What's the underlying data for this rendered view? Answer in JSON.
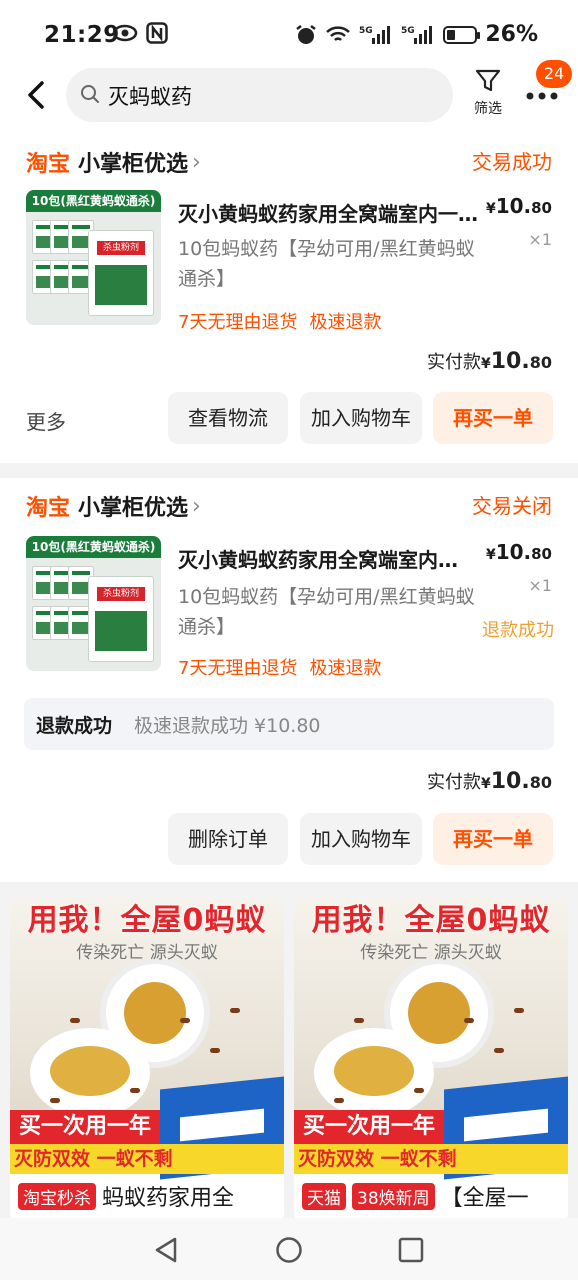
{
  "status": {
    "time": "21:29",
    "battery": "26%"
  },
  "search": {
    "query": "灭蚂蚁药",
    "filter_label": "筛选",
    "badge_count": "24"
  },
  "orders": [
    {
      "shop_brand": "淘宝",
      "shop_name": "小掌柜优选",
      "status": "交易成功",
      "product_title": "灭小黄蚂蚁药家用全窝端室内一次性杀",
      "price_symbol": "¥",
      "price_int": "10.",
      "price_dec": "80",
      "sku": "10包蚂蚁药【孕幼可用/黑红黄蚂蚁通杀】",
      "qty": "×1",
      "tags": [
        "7天无理由退货",
        "极速退款"
      ],
      "paid_label": "实付款",
      "paid_int": "10.",
      "paid_dec": "80",
      "more_label": "更多",
      "buttons": [
        "查看物流",
        "加入购物车",
        "再买一单"
      ],
      "thumb_banner": "10包(黑红黄蚂蚁通杀)",
      "thumb_label": "杀虫粉剂"
    },
    {
      "shop_brand": "淘宝",
      "shop_name": "小掌柜优选",
      "status": "交易关闭",
      "product_title": "灭小黄蚂蚁药家用全窝端室内一次性杀",
      "price_symbol": "¥",
      "price_int": "10.",
      "price_dec": "80",
      "sku": "10包蚂蚁药【孕幼可用/黑红黄蚂蚁通杀】",
      "qty": "×1",
      "refund_tag": "退款成功",
      "tags": [
        "7天无理由退货",
        "极速退款"
      ],
      "refund_title": "退款成功",
      "refund_desc": "极速退款成功 ¥10.80",
      "paid_label": "实付款",
      "paid_int": "10.",
      "paid_dec": "80",
      "buttons": [
        "删除订单",
        "加入购物车",
        "再买一单"
      ],
      "thumb_banner": "10包(黑红黄蚂蚁通杀)",
      "thumb_label": "杀虫粉剂"
    }
  ],
  "recommendations": [
    {
      "headline": "用我！全屋0蚂蚁",
      "sub": "传染死亡 源头灭蚁",
      "strip1": "买一次用一年",
      "strip2": "灭防双效 一蚁不剩",
      "pill": "淘宝秒杀",
      "pill_color": "#e3262c",
      "pill2": "",
      "caption": "蚂蚁药家用全"
    },
    {
      "headline": "用我！全屋0蚂蚁",
      "sub": "传染死亡 源头灭蚁",
      "strip1": "买一次用一年",
      "strip2": "灭防双效 一蚁不剩",
      "pill": "天猫",
      "pill_color": "#e3262c",
      "pill2": "38焕新周",
      "caption": "【全屋一"
    }
  ]
}
